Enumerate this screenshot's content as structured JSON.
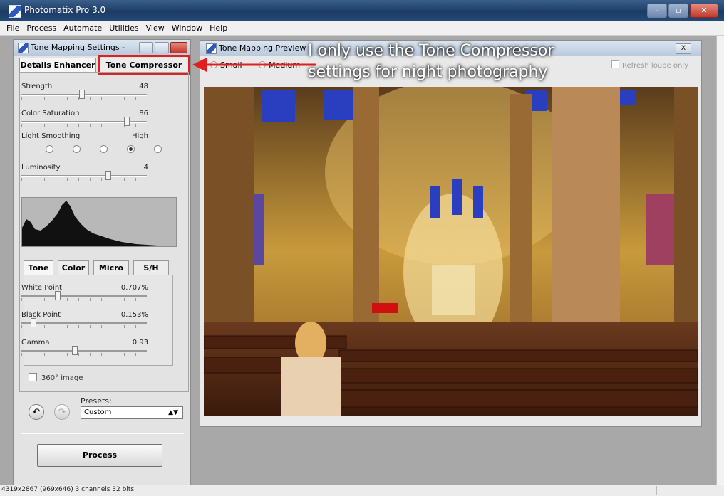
{
  "app": {
    "title": "Photomatix Pro 3.0"
  },
  "menu": [
    "File",
    "Process",
    "Automate",
    "Utilities",
    "View",
    "Window",
    "Help"
  ],
  "settings_panel": {
    "title": "Tone Mapping Settings -",
    "tabs": [
      "Details Enhancer",
      "Tone Compressor"
    ],
    "active_tab": "Details Enhancer",
    "sliders": [
      {
        "label": "Strength",
        "value": "48",
        "level": 0.48
      },
      {
        "label": "Color Saturation",
        "value": "86",
        "level": 0.86
      },
      {
        "label": "Luminosity",
        "value": "4",
        "level": 0.7
      }
    ],
    "light_smoothing": {
      "label": "Light Smoothing",
      "high_label": "High",
      "selected_index": 3,
      "count": 5
    },
    "subtabs": [
      "Tone",
      "Color",
      "Micro",
      "S/H"
    ],
    "tone_sliders": [
      {
        "label": "White Point",
        "value": "0.707%",
        "level": 0.28
      },
      {
        "label": "Black Point",
        "value": "0.153%",
        "level": 0.08
      },
      {
        "label": "Gamma",
        "value": "0.93",
        "level": 0.42
      }
    ],
    "checkbox_360": "360° image",
    "presets_label": "Presets:",
    "preset_value": "Custom",
    "process_label": "Process"
  },
  "preview_window": {
    "title": "Tone Mapping Preview -",
    "close_label": "X",
    "zoom_options": [
      "Small",
      "Medium"
    ],
    "refresh_label": "Refresh loupe only"
  },
  "annotation": {
    "line1": "I only use the Tone Compressor",
    "line2": "settings for night photography",
    "color": "#e02020"
  },
  "status": {
    "text": "4319x2867 (969x646) 3 channels 32 bits"
  }
}
